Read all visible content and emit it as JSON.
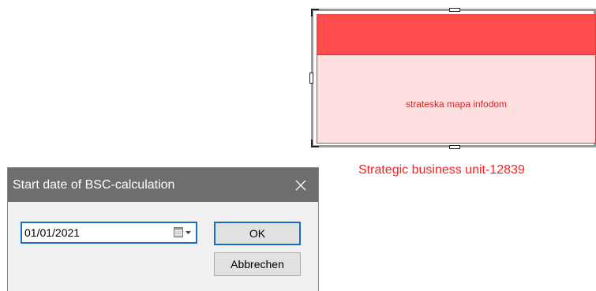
{
  "diagram": {
    "shape_label": "strateska mapa infodom",
    "caption": "Strategic business unit-12839",
    "colors": {
      "header": "#ff4c4c",
      "body": "#ffe0e0",
      "text": "#e02020",
      "caption": "#ff2020"
    }
  },
  "dialog": {
    "title": "Start date of BSC-calculation",
    "close_icon": "close-icon",
    "date_field": {
      "value": "01/01/2021",
      "icon": "calendar-dropdown-icon"
    },
    "ok_label": "OK",
    "cancel_label": "Abbrechen",
    "colors": {
      "titlebar": "#6e6e6e",
      "focus": "#1a6fc4"
    }
  }
}
